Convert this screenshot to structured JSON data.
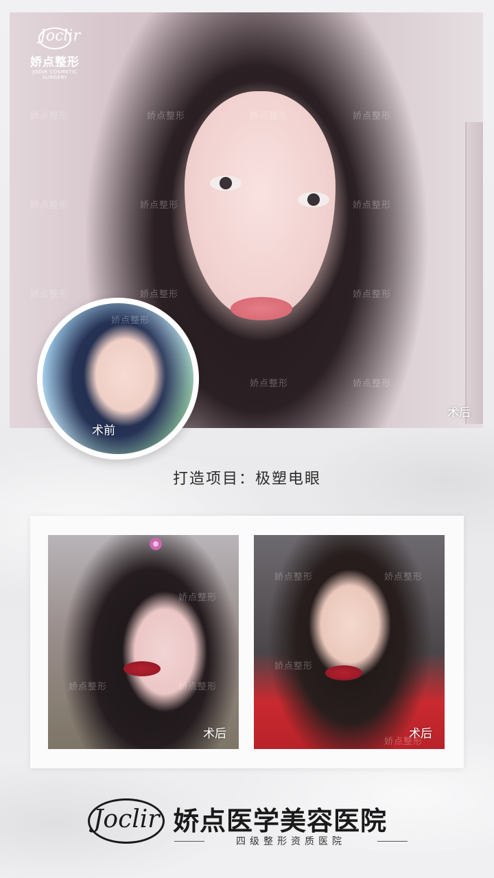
{
  "brand": {
    "top_logo_script": "Joclir",
    "top_logo_cn": "娇点整形",
    "top_logo_en": "JODIR COSMETIC SURGERY",
    "watermark": "娇点整形",
    "footer_logo_script": "Joclir",
    "footer_title": "娇点医学美容医院",
    "footer_subtitle": "四级整形资质医院"
  },
  "hero": {
    "after_label": "术后"
  },
  "before": {
    "label": "术前"
  },
  "project": {
    "text": "打造项目：极塑电眼"
  },
  "gallery": [
    {
      "label": "术后"
    },
    {
      "label": "术后"
    }
  ],
  "colors": {
    "background": "#efeff1",
    "panel": "#fbfbfc",
    "text_dark": "#1a1a1a"
  }
}
